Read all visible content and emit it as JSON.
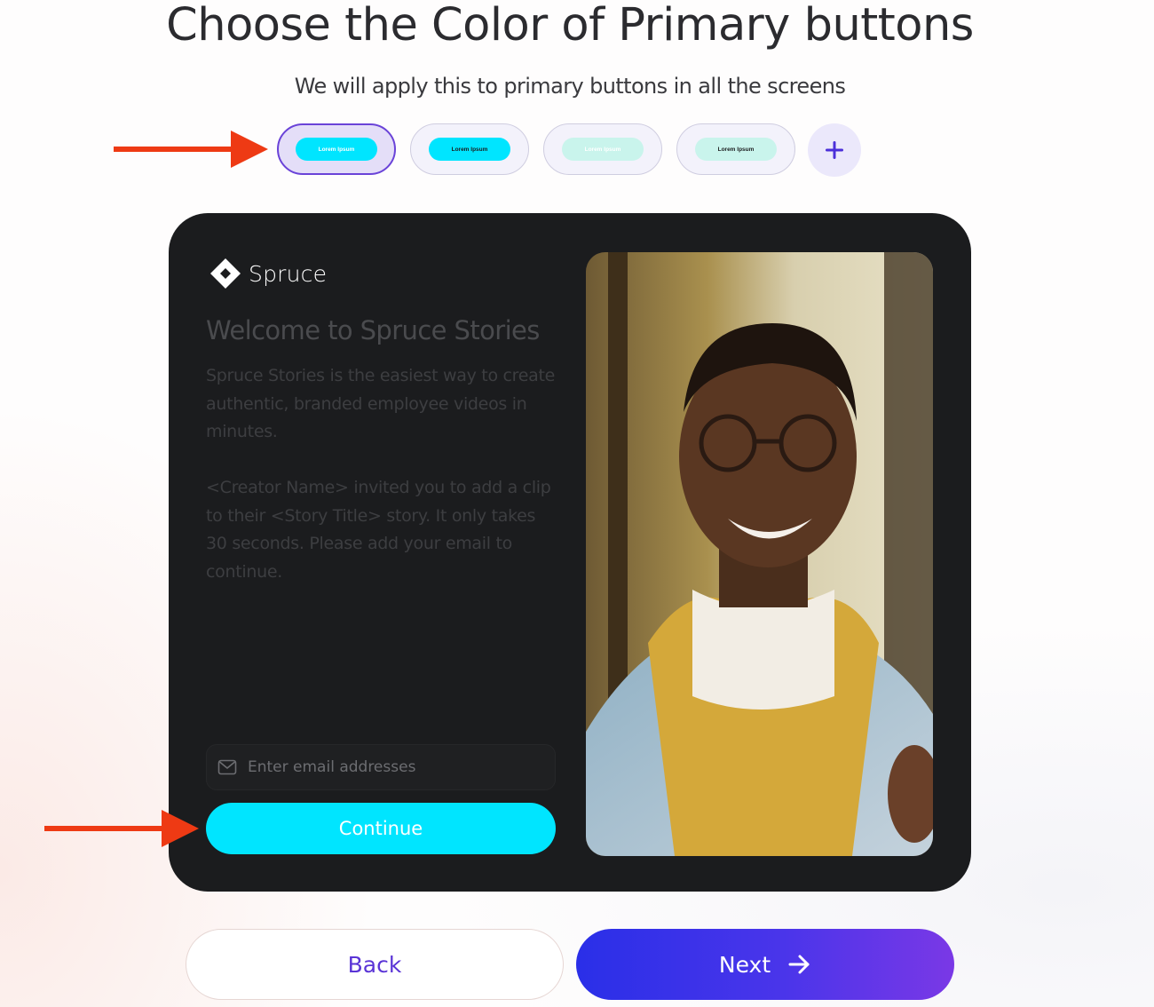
{
  "header": {
    "title": "Choose the Color of Primary buttons",
    "subtitle": "We will apply this to primary buttons in all the screens"
  },
  "swatches": [
    {
      "label": "Lorem Ipsum",
      "fill": "#00e5ff",
      "text_color": "#ffffff",
      "selected": true
    },
    {
      "label": "Lorem Ipsum",
      "fill": "#00e5ff",
      "text_color": "#1b1c1e",
      "selected": false
    },
    {
      "label": "Lorem Ipsum",
      "fill": "#c9f4ec",
      "text_color": "#ffffff",
      "selected": false
    },
    {
      "label": "Lorem Ipsum",
      "fill": "#c9f4ec",
      "text_color": "#1b1c1e",
      "selected": false
    }
  ],
  "add_swatch_icon": "plus-icon",
  "preview": {
    "logo_text": "Spruce",
    "heading": "Welcome to Spruce Stories",
    "paragraph1": "Spruce Stories is the easiest way to create authentic, branded employee videos in minutes.",
    "paragraph2": "<Creator Name> invited you to add a clip to their <Story Title> story. It only takes 30 seconds. Please add your email to continue.",
    "email_placeholder": "Enter email addresses",
    "email_icon": "mail-icon",
    "continue_label": "Continue",
    "photo": "smiling-man-video-frame"
  },
  "footer": {
    "back_label": "Back",
    "next_label": "Next",
    "next_icon": "arrow-right-icon"
  },
  "colors": {
    "accent_primary": "#00e5ff",
    "card_background": "#1b1c1e",
    "selection_border": "#6a43d8",
    "next_gradient_start": "#2a2fe8",
    "next_gradient_end": "#7a38e6",
    "annotation_arrow": "#ee3a14"
  }
}
